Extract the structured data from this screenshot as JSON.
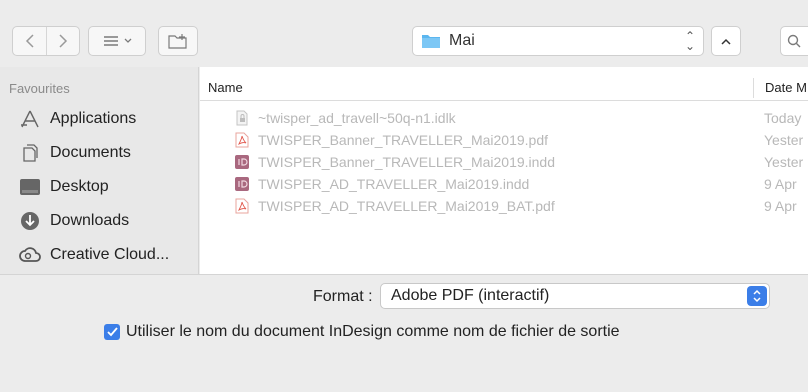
{
  "toolbar": {
    "back_icon": "chevron-left-icon",
    "forward_icon": "chevron-right-icon",
    "view_icon": "list-view-icon",
    "new_folder_icon": "new-folder-icon",
    "location": "Mai",
    "search_icon": "search-icon"
  },
  "sidebar": {
    "heading": "Favourites",
    "items": [
      {
        "label": "Applications",
        "icon": "applications-icon"
      },
      {
        "label": "Documents",
        "icon": "documents-icon"
      },
      {
        "label": "Desktop",
        "icon": "desktop-icon"
      },
      {
        "label": "Downloads",
        "icon": "downloads-icon"
      },
      {
        "label": "Creative Cloud...",
        "icon": "creative-cloud-icon"
      }
    ]
  },
  "filelist": {
    "columns": {
      "name": "Name",
      "date": "Date M"
    },
    "rows": [
      {
        "name": "~twisper_ad_travell~50q-n1.idlk",
        "date": "Today",
        "icon": "lock-file-icon"
      },
      {
        "name": "TWISPER_Banner_TRAVELLER_Mai2019.pdf",
        "date": "Yester",
        "icon": "pdf-file-icon"
      },
      {
        "name": "TWISPER_Banner_TRAVELLER_Mai2019.indd",
        "date": "Yester",
        "icon": "indd-file-icon"
      },
      {
        "name": "TWISPER_AD_TRAVELLER_Mai2019.indd",
        "date": "9 Apr",
        "icon": "indd-file-icon"
      },
      {
        "name": "TWISPER_AD_TRAVELLER_Mai2019_BAT.pdf",
        "date": "9 Apr",
        "icon": "pdf-file-icon"
      }
    ]
  },
  "options": {
    "format_label": "Format :",
    "format_value": "Adobe PDF (interactif)",
    "checkbox_checked": true,
    "checkbox_label": "Utiliser le nom du document InDesign comme nom de fichier de sortie"
  },
  "colors": {
    "accent": "#3b7ee8",
    "disabled_text": "#b8b8b8",
    "pdf_icon": "#e2574c",
    "indd_icon": "#8a3d5a"
  }
}
